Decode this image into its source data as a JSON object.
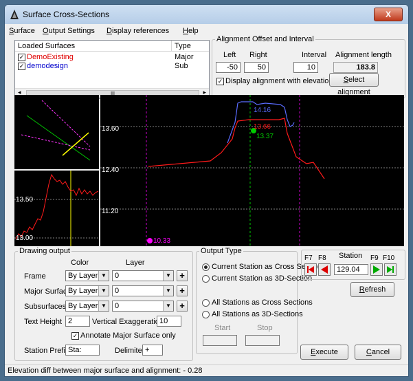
{
  "window": {
    "title": "Surface Cross-Sections",
    "close_glyph": "X"
  },
  "menu": [
    "Surface",
    "Output Settings",
    "Display references",
    "Help"
  ],
  "surfaces": {
    "header_name": "Loaded Surfaces",
    "header_type": "Type",
    "rows": [
      {
        "name": "DemoExisting",
        "type": "Major",
        "checked": true,
        "color": "#e00000"
      },
      {
        "name": "demodesign",
        "type": "Sub",
        "checked": true,
        "color": "#0000cc"
      }
    ],
    "scroll_thumb": "III"
  },
  "alignment": {
    "legend": "Alignment Offset and Interval",
    "left_label": "Left",
    "right_label": "Right",
    "interval_label": "Interval",
    "length_label": "Alignment length",
    "left": "-50",
    "right": "50",
    "interval": "10",
    "length": "183.8",
    "display_label": "Display alignment with elevation",
    "display_checked": true,
    "select_label": "Select alignment"
  },
  "plot": {
    "elev_labels": [
      "13.60",
      "12.40",
      "11.20"
    ],
    "point_labels": {
      "design_top": "14.16",
      "existing_top": "13.66",
      "green": "13.37",
      "magenta": "10.33"
    },
    "profile_labels": [
      "13.50",
      "13.00"
    ],
    "colors": {
      "existing": "#ff1a1a",
      "design": "#5a6cff",
      "green": "#00cc00",
      "magenta": "#ff00ff",
      "yellow": "#ffff00"
    }
  },
  "drawing": {
    "legend": "Drawing output",
    "col_color": "Color",
    "col_layer": "Layer",
    "rows": [
      {
        "label": "Frame",
        "color": "By Layer",
        "layer": "0"
      },
      {
        "label": "Major Surface",
        "color": "By Layer",
        "layer": "0"
      },
      {
        "label": "Subsurfaces",
        "color": "By Layer",
        "layer": "0"
      }
    ],
    "text_height_label": "Text Height",
    "text_height": "2",
    "vert_exag_label": "Vertical Exaggeration",
    "vert_exag": "10",
    "annotate_label": "Annotate Major Surface only",
    "annotate_checked": true,
    "prefix_label": "Station Prefix",
    "prefix": "Sta:",
    "delimiter_label": "Delimiter",
    "delimiter": "+"
  },
  "output": {
    "legend": "Output Type",
    "options": [
      "Current Station as Cross Section",
      "Current Station as 3D-Section",
      "All Stations as Cross Sections",
      "All Stations as 3D-Sections"
    ],
    "selected": 0,
    "start_label": "Start",
    "stop_label": "Stop",
    "start": "",
    "stop": ""
  },
  "station": {
    "f7": "F7",
    "f8": "F8",
    "f9": "F9",
    "f10": "F10",
    "label": "Station",
    "value": "129.04"
  },
  "buttons": {
    "refresh": "Refresh",
    "execute": "Execute",
    "cancel": "Cancel"
  },
  "status": "Elevation diff between major surface and alignment: - 0.28"
}
